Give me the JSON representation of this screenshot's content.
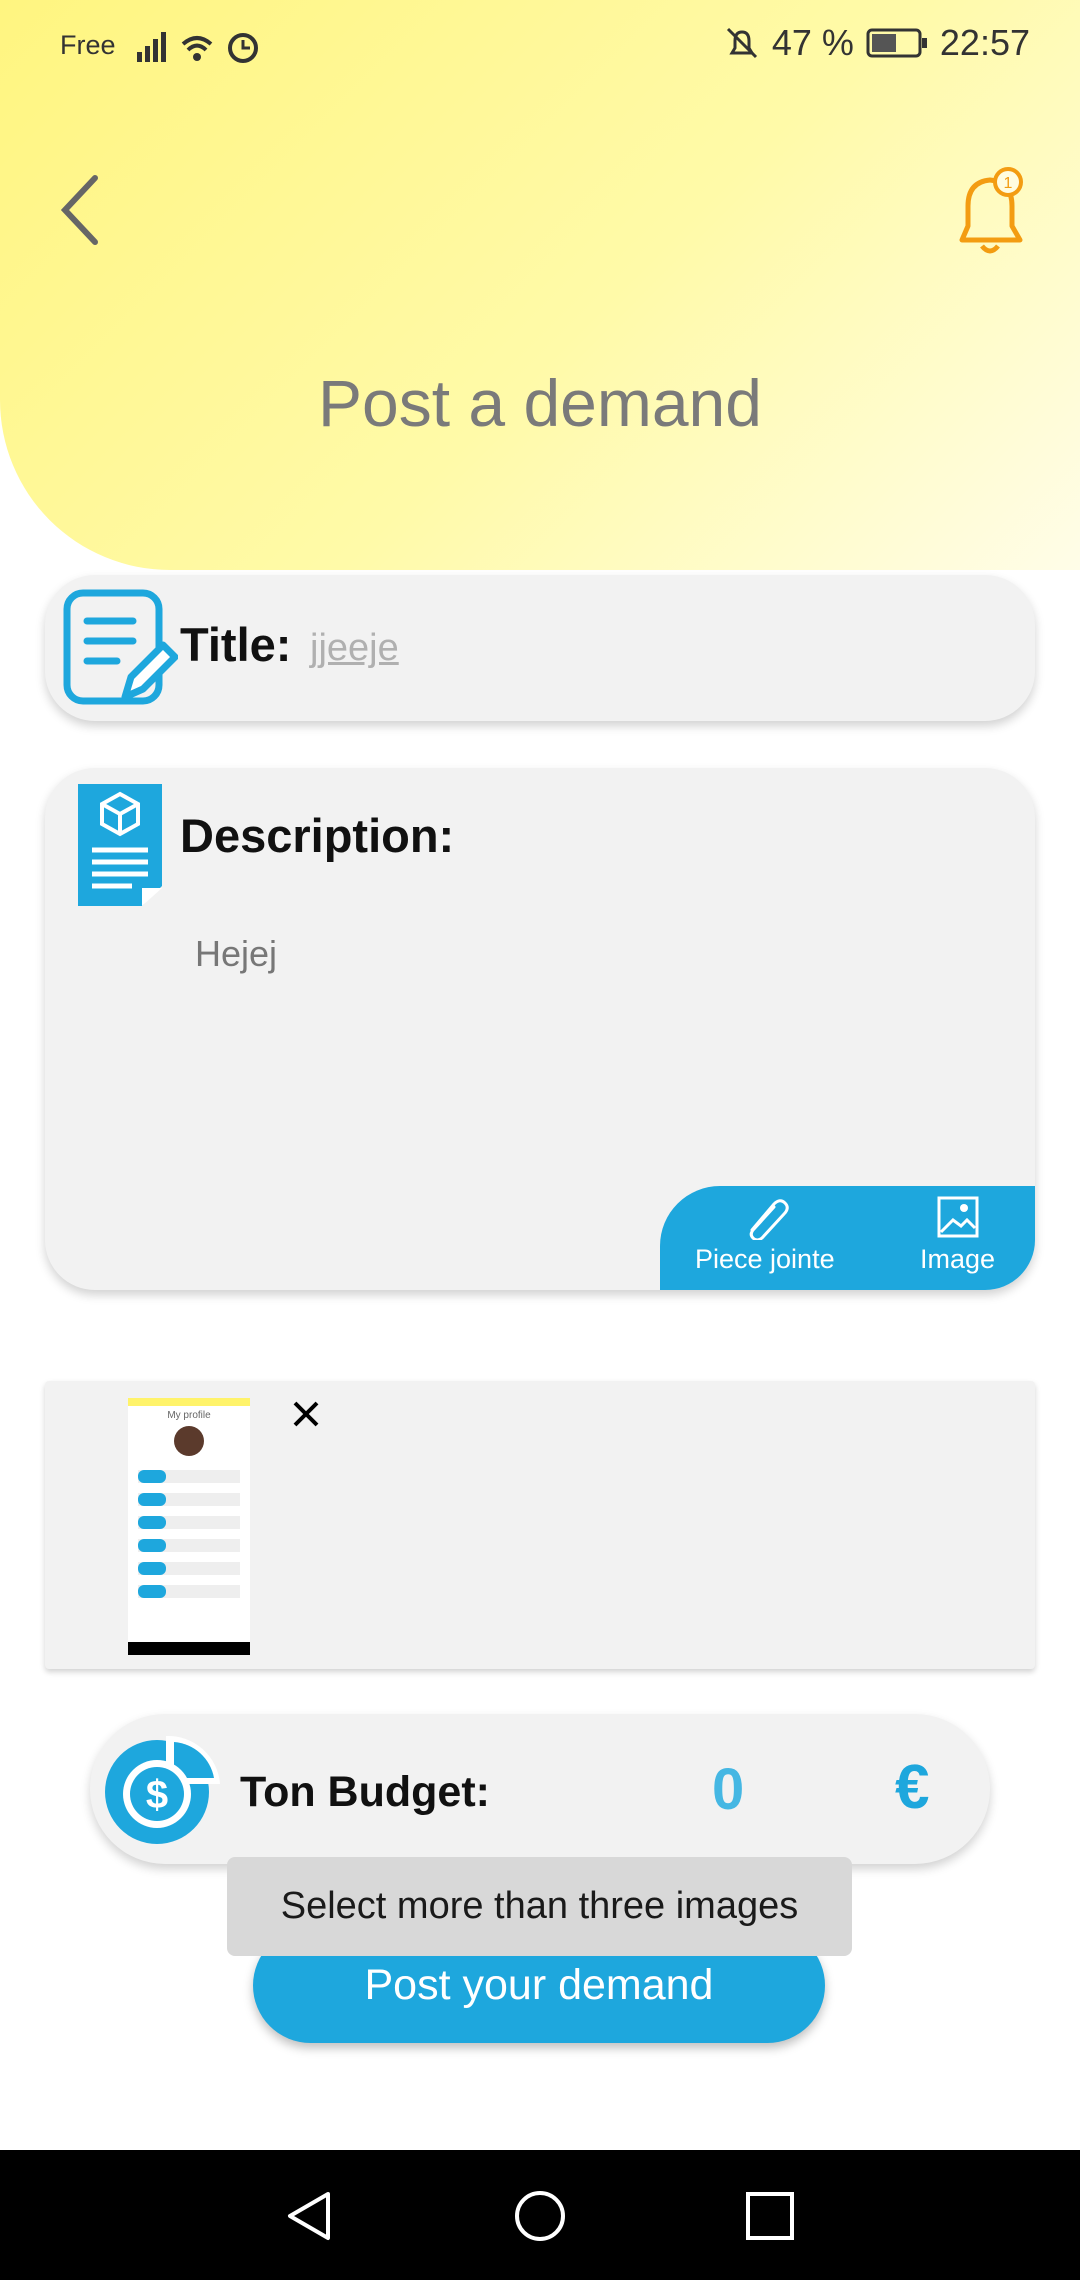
{
  "status_bar": {
    "carrier": "Free",
    "battery": "47 %",
    "time": "22:57"
  },
  "header": {
    "title": "Post a demand",
    "back_icon": "chevron-left-icon",
    "notification_icon": "bell-icon"
  },
  "title_field": {
    "label": "Title:",
    "value": "jjeeje",
    "icon": "document-edit-icon"
  },
  "description_field": {
    "label": "Description:",
    "value": "Hejej",
    "icon": "package-document-icon"
  },
  "attachments": {
    "attach_label": "Piece jointe",
    "image_label": "Image"
  },
  "selected_images": {
    "thumbnail_title": "My profile"
  },
  "budget": {
    "label": "Ton Budget:",
    "amount": "0",
    "currency": "€",
    "icon": "dollar-coin-icon"
  },
  "toast": {
    "message": "Select more than three images"
  },
  "post_button": {
    "label": "Post your demand"
  },
  "colors": {
    "accent": "#1ea7dd",
    "header_yellow": "#fff580",
    "notification_orange": "#f39c12",
    "card_bg": "#f2f2f2"
  }
}
